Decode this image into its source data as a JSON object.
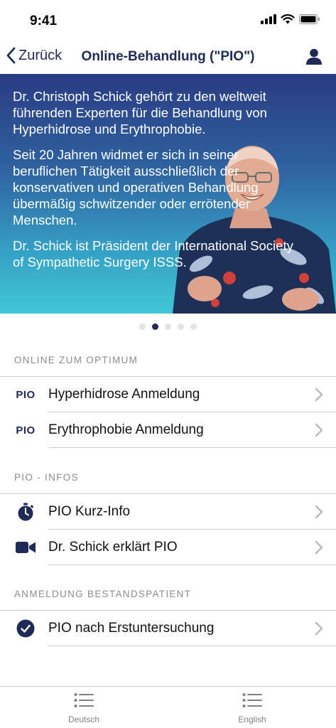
{
  "status_bar": {
    "time": "9:41"
  },
  "nav": {
    "back_label": "Zurück",
    "title": "Online-Behandlung (\"PIO\")"
  },
  "hero": {
    "paragraphs": [
      "Dr. Christoph Schick gehört zu den weltweit führenden Experten für die Behandlung von Hyperhidrose und Erythrophobie.",
      "Seit 20 Jahren widmet er sich in seiner beruflichen Tätigkeit ausschließlich der konservativen und operativen Behandlung übermäßig schwitzender oder errötender Menschen.",
      "Dr. Schick ist Präsident der International Society of Sympathetic Surgery ISSS."
    ],
    "page_count": 5,
    "active_page": 2
  },
  "sections": [
    {
      "title": "ONLINE ZUM OPTIMUM",
      "rows": [
        {
          "icon": "pio-text-icon",
          "icon_text": "PIO",
          "label": "Hyperhidrose Anmeldung"
        },
        {
          "icon": "pio-text-icon",
          "icon_text": "PIO",
          "label": "Erythrophobie Anmeldung"
        }
      ]
    },
    {
      "title": "PIO - INFOS",
      "rows": [
        {
          "icon": "stopwatch-icon",
          "label": "PIO Kurz-Info"
        },
        {
          "icon": "video-camera-icon",
          "label": "Dr. Schick erklärt PIO"
        }
      ]
    },
    {
      "title": "ANMELDUNG BESTANDSPATIENT",
      "rows": [
        {
          "icon": "checkmark-circle-icon",
          "label": "PIO nach Erstuntersuchung"
        }
      ]
    }
  ],
  "tabs": [
    {
      "icon": "list-icon",
      "label": "Deutsch"
    },
    {
      "icon": "list-icon",
      "label": "English"
    }
  ],
  "colors": {
    "accent": "#1f2a56",
    "chevron": "#b9b9be",
    "separator": "#cfcfd3"
  }
}
